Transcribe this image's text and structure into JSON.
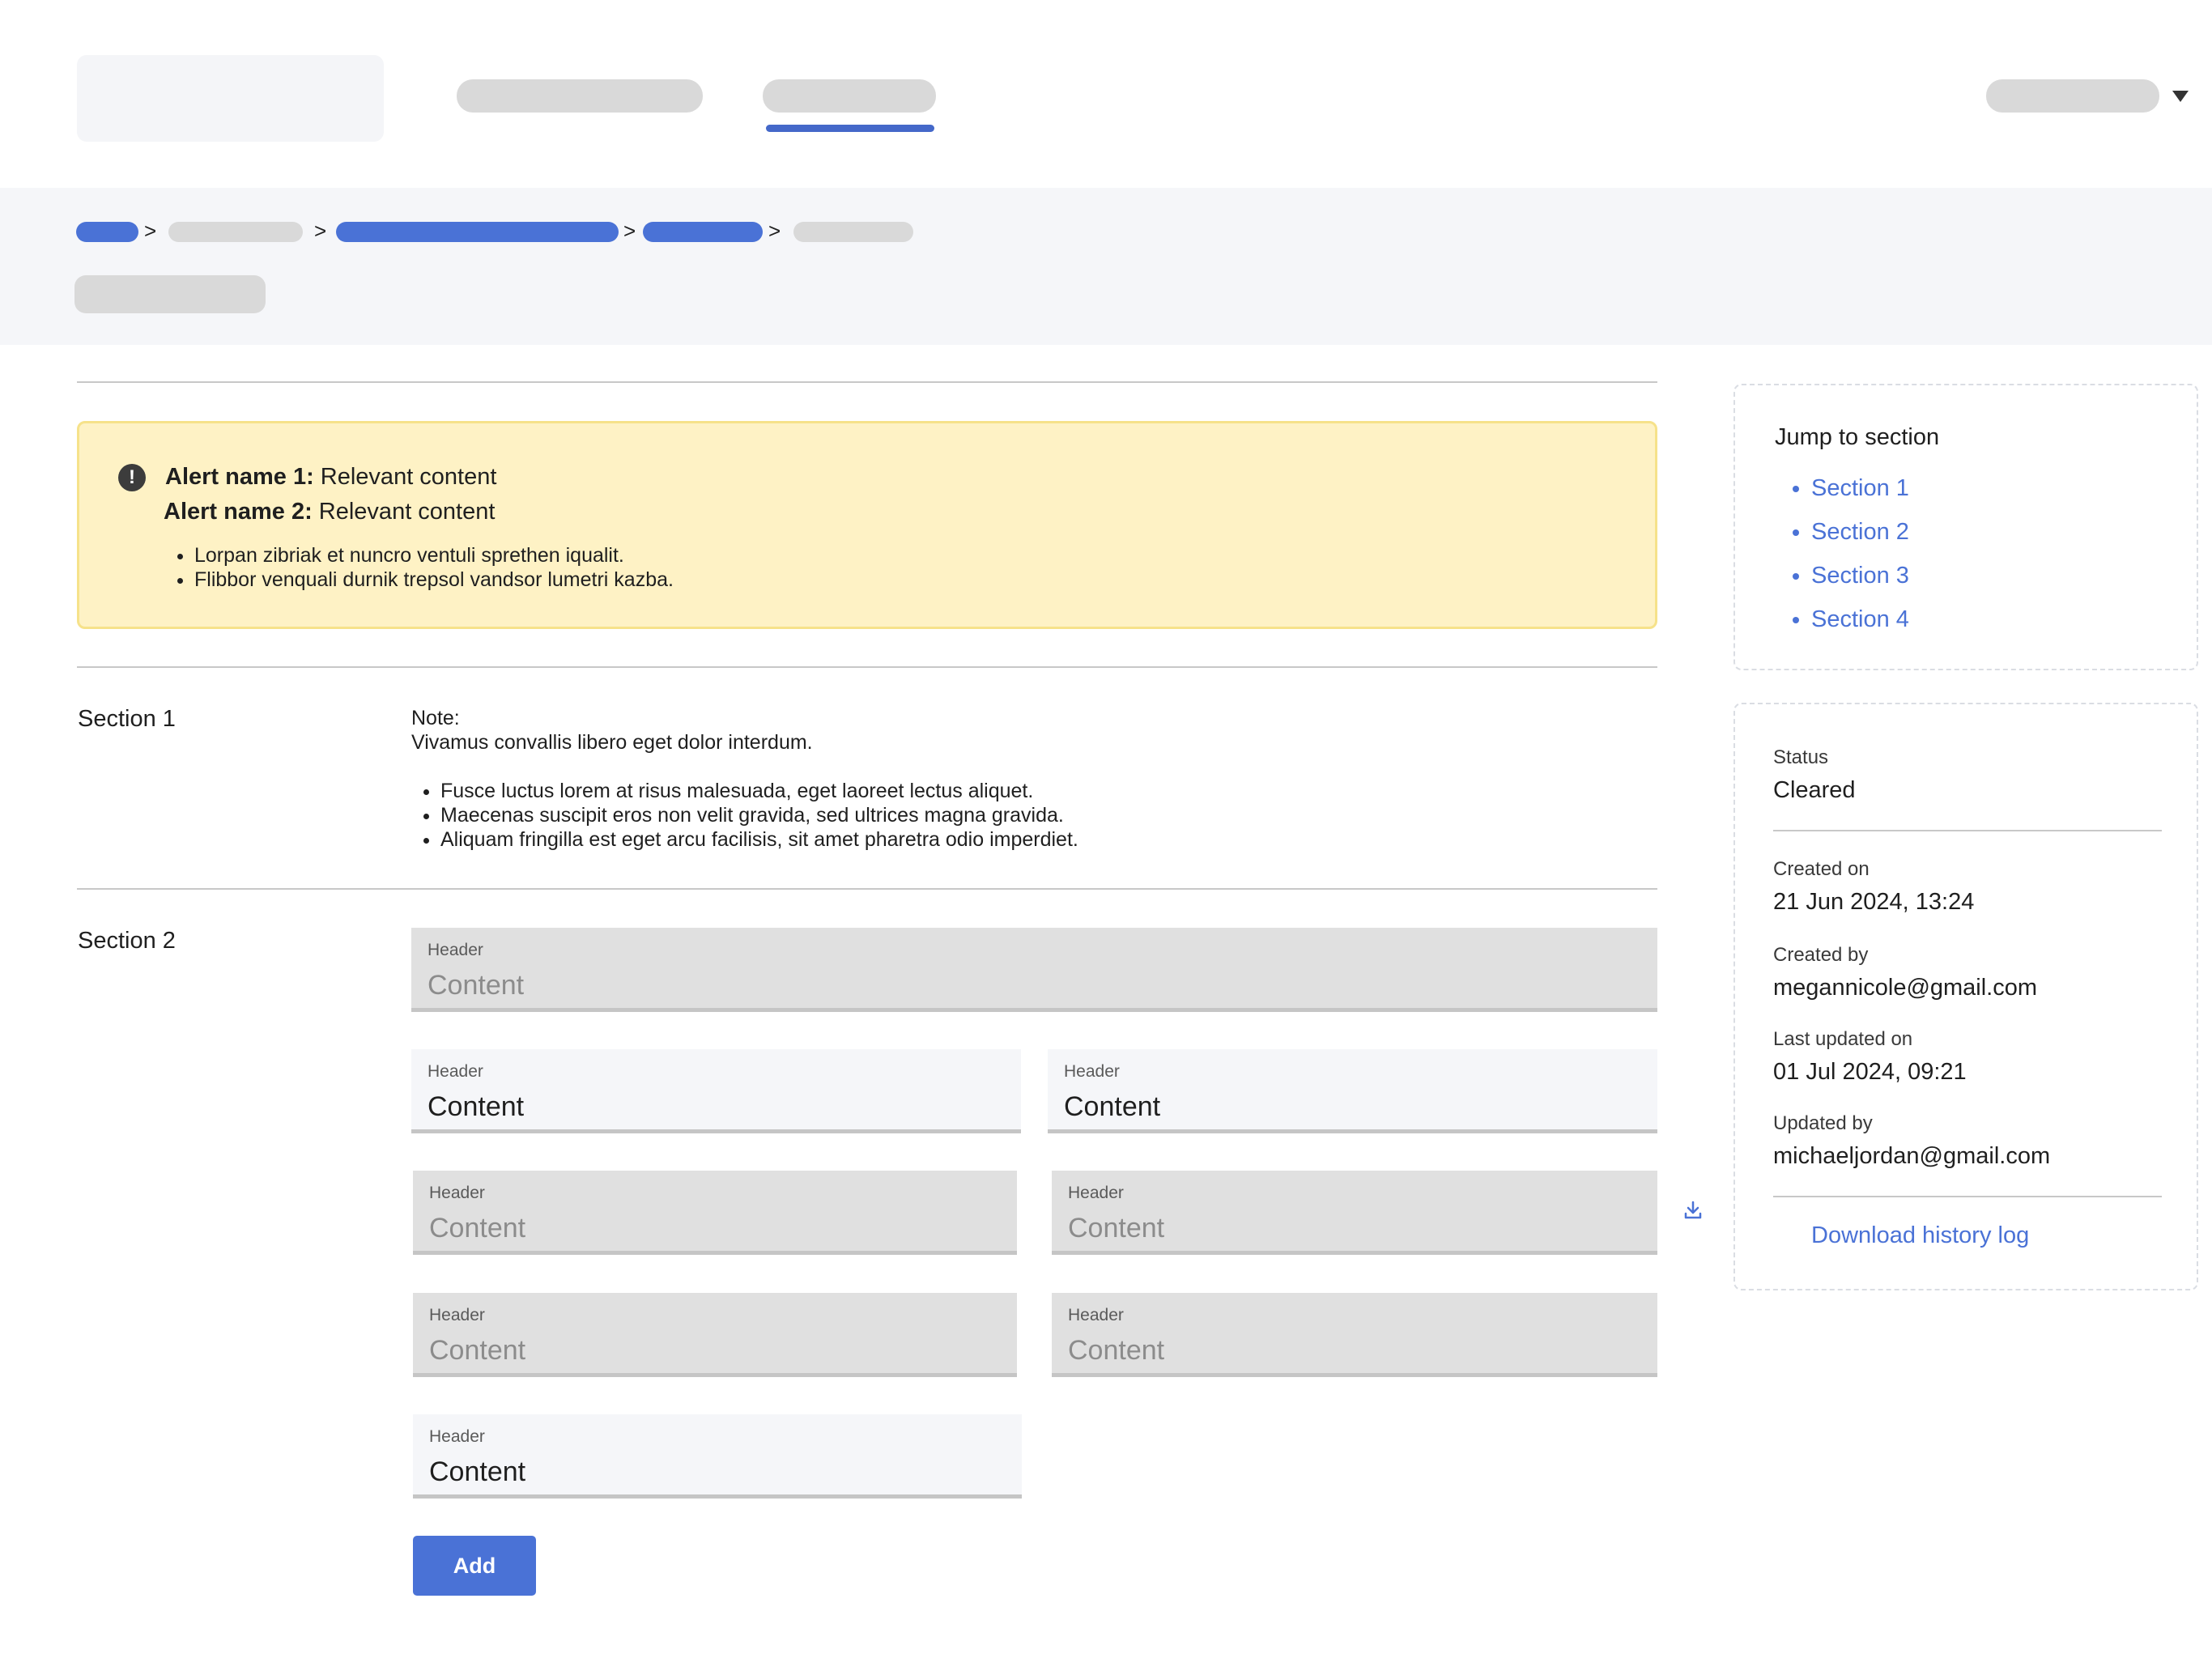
{
  "breadcrumb": {
    "separators": [
      ">",
      ">",
      ">",
      ">"
    ]
  },
  "alert": {
    "line1_name": "Alert name 1:",
    "line1_text": " Relevant content",
    "line2_name": "Alert name 2:",
    "line2_text": " Relevant content",
    "bullets": [
      "Lorpan zibriak et nuncro ventuli sprethen iqualit.",
      "Flibbor venquali durnik trepsol vandsor lumetri kazba."
    ],
    "icon": "alert-exclamation-icon",
    "icon_glyph": "!"
  },
  "section1": {
    "label": "Section 1",
    "note_title": "Note:",
    "note_text": "Vivamus convallis libero eget dolor interdum.",
    "bullets": [
      "Fusce luctus lorem at risus malesuada, eget laoreet lectus aliquet.",
      "Maecenas suscipit eros non velit gravida, sed ultrices magna gravida.",
      "Aliquam fringilla est eget arcu facilisis, sit amet pharetra odio imperdiet."
    ]
  },
  "section2": {
    "label": "Section 2",
    "fields": [
      {
        "header": "Header",
        "content": "Content",
        "state": "disabled"
      },
      {
        "header": "Header",
        "content": "Content",
        "state": "enabled"
      },
      {
        "header": "Header",
        "content": "Content",
        "state": "enabled"
      },
      {
        "header": "Header",
        "content": "Content",
        "state": "disabled"
      },
      {
        "header": "Header",
        "content": "Content",
        "state": "disabled"
      },
      {
        "header": "Header",
        "content": "Content",
        "state": "disabled"
      },
      {
        "header": "Header",
        "content": "Content",
        "state": "disabled"
      },
      {
        "header": "Header",
        "content": "Content",
        "state": "enabled"
      }
    ],
    "add_label": "Add",
    "side_icon": "download-icon"
  },
  "jump": {
    "title": "Jump to section",
    "items": [
      "Section 1",
      "Section 2",
      "Section 3",
      "Section 4"
    ]
  },
  "meta": {
    "status_label": "Status",
    "status_value": "Cleared",
    "created_on_label": "Created on",
    "created_on_value": "21 Jun 2024, 13:24",
    "created_by_label": "Created by",
    "created_by_value": "megannicole@gmail.com",
    "updated_on_label": "Last updated on",
    "updated_on_value": "01 Jul 2024, 09:21",
    "updated_by_label": "Updated by",
    "updated_by_value": "michaeljordan@gmail.com",
    "download_label": "Download history log"
  },
  "colors": {
    "accent": "#4a72d6",
    "alert_bg": "#fef2c5",
    "alert_border": "#f6e28a",
    "band_bg": "#f5f6f9",
    "placeholder": "#d9d9d9"
  }
}
